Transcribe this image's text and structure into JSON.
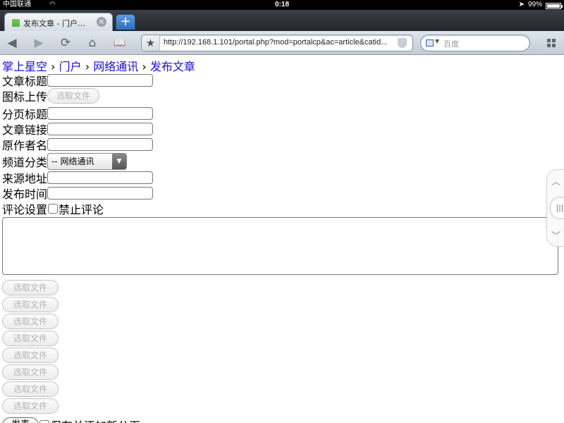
{
  "status_bar": {
    "carrier": "中国联通",
    "time": "0:18",
    "battery": "99%",
    "battery_level": 0.99
  },
  "tabs": [
    {
      "title": "发布文章 - 门户管...",
      "close": "×"
    }
  ],
  "new_tab_label": "+",
  "toolbar": {
    "back": "◀",
    "forward": "▶",
    "reload": "⟳",
    "home": "⌂",
    "bookmarks": "📖",
    "url": "http://192.168.1.101/portal.php?mod=portalcp&ac=article&catid...",
    "search_placeholder": "百度"
  },
  "breadcrumb": {
    "items": [
      "掌上星空",
      "门户",
      "网络通讯",
      "发布文章"
    ],
    "separator": "›"
  },
  "form": {
    "title_label": "文章标题",
    "icon_label": "图标上传",
    "file_button": "选取文件",
    "page_title_label": "分页标题",
    "link_label": "文章链接",
    "author_label": "原作者名",
    "channel_label": "频道分类",
    "channel_value": "-- 网络通讯",
    "source_label": "来源地址",
    "publish_time_label": "发布时间",
    "comment_label": "评论设置",
    "disable_comment_label": "禁止评论",
    "attachments": [
      "选取文件",
      "选取文件",
      "选取文件",
      "选取文件",
      "选取文件",
      "选取文件",
      "选取文件",
      "选取文件"
    ],
    "submit_button": "发表",
    "add_page_label": "保存并添加新分页"
  },
  "scroll_widget": {
    "up": "︿",
    "mid": "|||",
    "down": "﹀"
  }
}
